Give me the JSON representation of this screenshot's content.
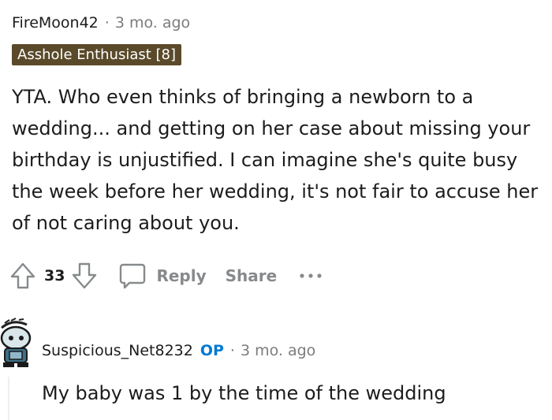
{
  "comment": {
    "username": "FireMoon42",
    "separator": "·",
    "age": "3 mo. ago",
    "flair": "Asshole Enthusiast [8]",
    "body": "YTA. Who even thinks of bringing a newborn to a wedding... and getting on her case about missing your birthday is unjustified. I can imagine she's quite busy the week before her wedding, it's not fair to accuse her of not caring about you.",
    "vote_count": "33",
    "reply_label": "Reply",
    "share_label": "Share"
  },
  "reply": {
    "username": "Suspicious_Net8232",
    "op_badge": "OP",
    "separator": "·",
    "age": "3 mo. ago",
    "body": "My baby was 1 by the time of the wedding"
  },
  "icons": {
    "upvote": "upvote-arrow-icon",
    "downvote": "downvote-arrow-icon",
    "reply": "speech-bubble-icon",
    "more": "more-dots-icon",
    "avatar": "snoo-avatar-icon"
  },
  "colors": {
    "flair_bg": "#5a4a2a",
    "op_badge": "#0079d3",
    "muted_text": "#7c7c7c",
    "action_text": "#878a8c"
  }
}
